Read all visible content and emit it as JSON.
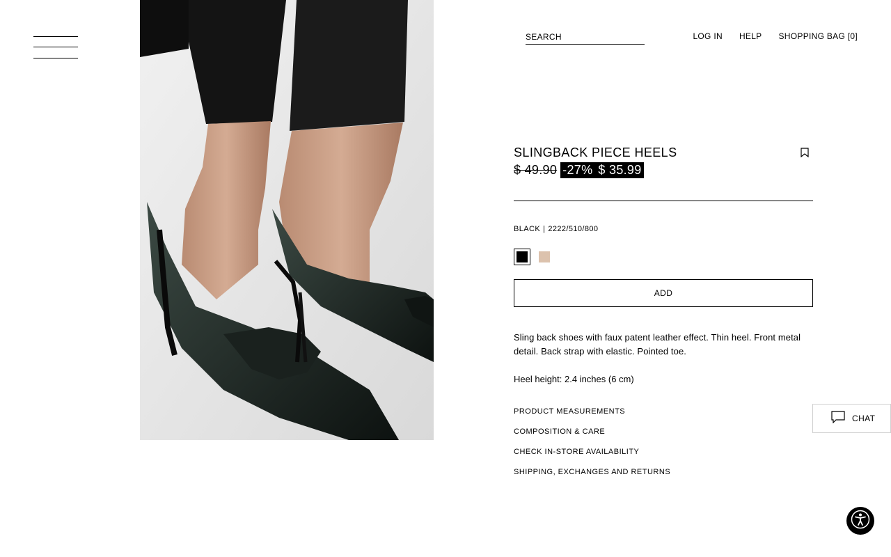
{
  "header": {
    "search_placeholder": "SEARCH",
    "nav": {
      "login": "LOG IN",
      "help": "HELP",
      "bag": "SHOPPING BAG [0]"
    }
  },
  "product": {
    "title": "SLINGBACK PIECE HEELS",
    "old_price": "$ 49.90",
    "discount": "-27%",
    "price": "$ 35.99",
    "color_name": "BLACK",
    "separator": "|",
    "reference": "2222/510/800",
    "swatches": [
      {
        "name": "black",
        "color": "#000000",
        "selected": true
      },
      {
        "name": "beige",
        "color": "#dcc2ad",
        "selected": false
      }
    ],
    "add_label": "ADD",
    "description": "Sling back shoes with faux patent leather effect. Thin heel. Front metal detail. Back strap with elastic. Pointed toe.",
    "heel_height": "Heel height: 2.4 inches (6 cm)",
    "links": [
      "PRODUCT MEASUREMENTS",
      "COMPOSITION & CARE",
      "CHECK IN-STORE AVAILABILITY",
      "SHIPPING, EXCHANGES AND RETURNS"
    ]
  },
  "chat": {
    "label": "CHAT"
  },
  "icons": {
    "menu": "menu-icon",
    "bookmark": "bookmark-icon",
    "chat": "chat-bubble-icon",
    "accessibility": "accessibility-icon"
  }
}
